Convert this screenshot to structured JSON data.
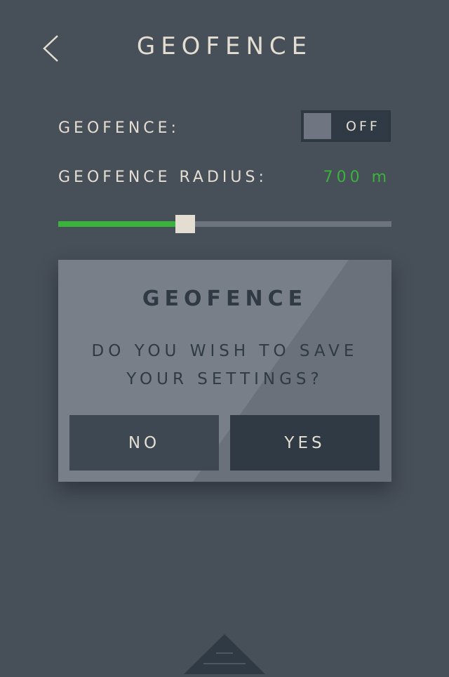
{
  "header": {
    "title": "GEOFENCE",
    "back_icon": "chevron-left-icon"
  },
  "settings": {
    "geofence_label": "GEOFENCE:",
    "toggle_state": "OFF",
    "radius_label": "GEOFENCE RADIUS:",
    "radius_value": "700 m",
    "slider_fraction": 0.38
  },
  "dialog": {
    "title": "GEOFENCE",
    "message": "DO YOU WISH TO SAVE\nYOUR SETTINGS?",
    "no_label": "NO",
    "yes_label": "YES"
  },
  "footer": {
    "handle_icon": "drawer-handle-icon"
  },
  "colors": {
    "background": "#474f59",
    "text": "#e4ddd2",
    "accent_green": "#3ab33b",
    "dialog_bg": "#797f89",
    "dark_button": "#2f3a45"
  }
}
